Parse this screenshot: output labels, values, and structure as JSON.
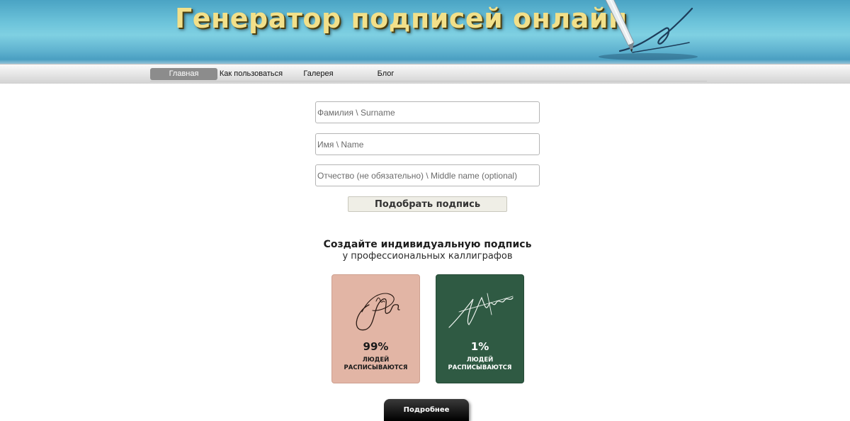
{
  "header": {
    "title": "Генератор подписей онлайн",
    "logo_icon": "pen-signature-icon"
  },
  "nav": {
    "items": [
      {
        "label": "Главная",
        "active": true
      },
      {
        "label": "Как пользоваться",
        "active": false
      },
      {
        "label": "Галерея",
        "active": false
      },
      {
        "label": "Блог",
        "active": false
      }
    ]
  },
  "form": {
    "surname_placeholder": "Фамилия \\ Surname",
    "name_placeholder": "Имя \\ Name",
    "middle_placeholder": "Отчество (не обязательно) \\ Middle name (optional)",
    "submit_label": "Подобрать подпись"
  },
  "promo": {
    "title": "Создайте индивидуальную подпись",
    "subtitle": "у профессиональных каллиграфов",
    "cards": [
      {
        "percent": "99%",
        "caption_line1": "ЛЮДЕЙ",
        "caption_line2": "РАСПИСЫВАЮТСЯ",
        "color": "#e2b5a5"
      },
      {
        "percent": "1%",
        "caption_line1": "ЛЮДЕЙ",
        "caption_line2": "РАСПИСЫВАЮТСЯ",
        "color": "#2f5a43"
      }
    ],
    "more_label": "Подробнее"
  }
}
